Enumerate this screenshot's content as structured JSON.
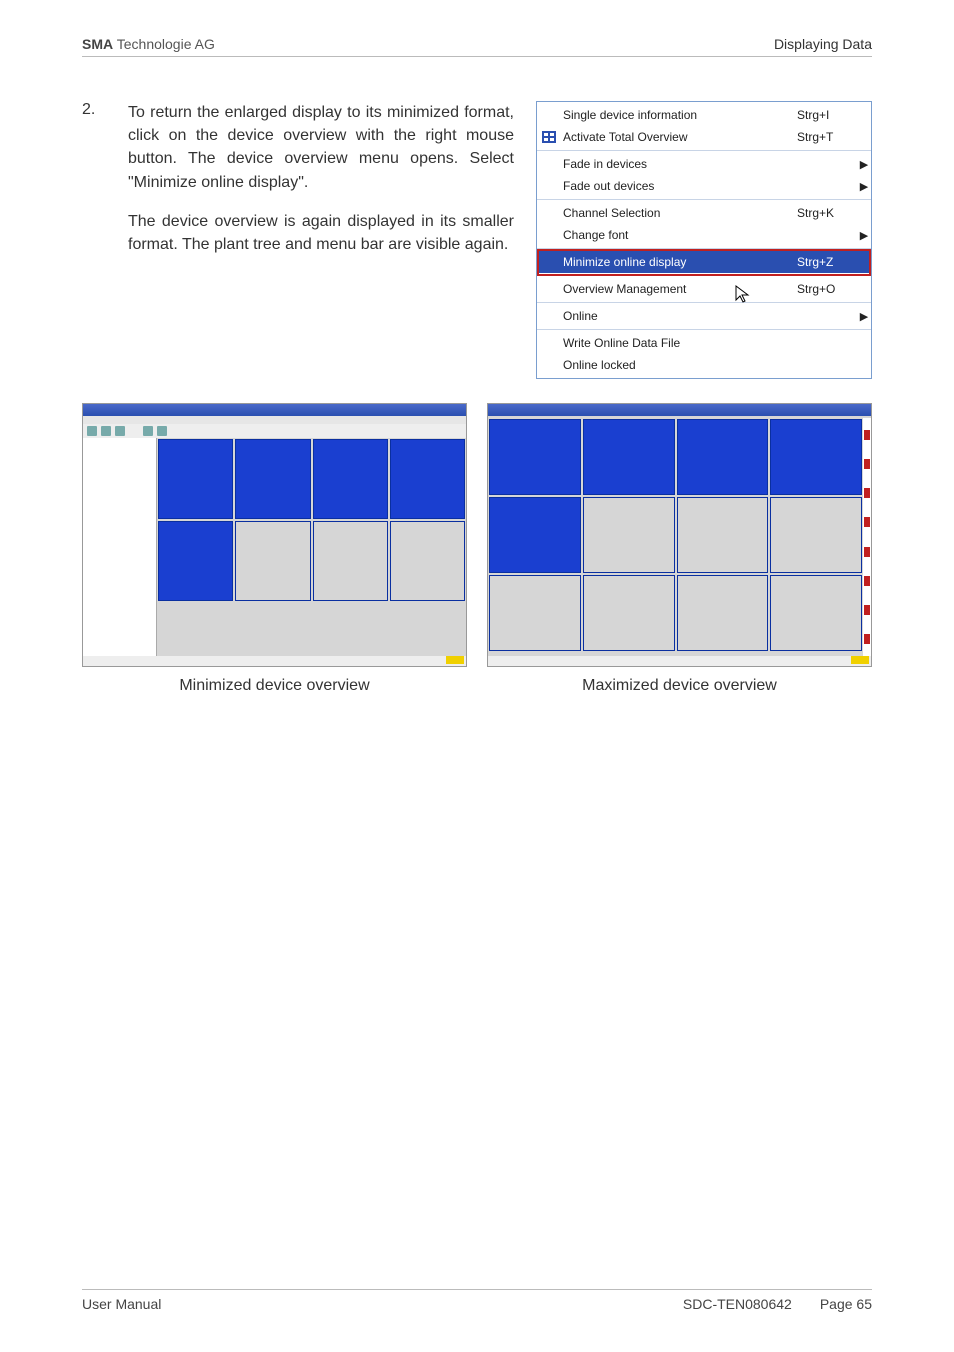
{
  "header": {
    "brand_bold": "SMA",
    "brand_rest": " Technologie AG",
    "section": "Displaying Data"
  },
  "step": {
    "number": "2.",
    "p1": "To return the enlarged display to its minimized format, click on the device overview with the right mouse button. The device overview menu opens. Select \"Minimize online display\".",
    "p2": "The device overview is again displayed in its smaller format. The plant tree and menu bar are visible again."
  },
  "menu": {
    "g1": [
      {
        "label": "Single device information",
        "shortcut": "Strg+I",
        "arrow": "",
        "highlight": false,
        "icon": ""
      },
      {
        "label": "Activate Total Overview",
        "shortcut": "Strg+T",
        "arrow": "",
        "highlight": false,
        "icon": "overview"
      }
    ],
    "g2": [
      {
        "label": "Fade in devices",
        "shortcut": "",
        "arrow": "▶",
        "highlight": false,
        "icon": ""
      },
      {
        "label": "Fade out devices",
        "shortcut": "",
        "arrow": "▶",
        "highlight": false,
        "icon": ""
      }
    ],
    "g3": [
      {
        "label": "Channel Selection",
        "shortcut": "Strg+K",
        "arrow": "",
        "highlight": false,
        "icon": ""
      },
      {
        "label": "Change font",
        "shortcut": "",
        "arrow": "▶",
        "highlight": false,
        "icon": ""
      }
    ],
    "g4": [
      {
        "label": "Minimize online display",
        "shortcut": "Strg+Z",
        "arrow": "",
        "highlight": true,
        "icon": ""
      }
    ],
    "g5": [
      {
        "label": "Overview Management",
        "shortcut": "Strg+O",
        "arrow": "",
        "highlight": false,
        "icon": ""
      }
    ],
    "g6": [
      {
        "label": "Online",
        "shortcut": "",
        "arrow": "▶",
        "highlight": false,
        "icon": ""
      }
    ],
    "g7": [
      {
        "label": "Write Online Data File",
        "shortcut": "",
        "arrow": "",
        "highlight": false,
        "icon": ""
      },
      {
        "label": "Online locked",
        "shortcut": "",
        "arrow": "",
        "highlight": false,
        "icon": ""
      }
    ]
  },
  "captions": {
    "left": "Minimized device overview",
    "right": "Maximized device overview"
  },
  "footer": {
    "left": "User Manual",
    "code": "SDC-TEN080642",
    "page": "Page 65"
  }
}
